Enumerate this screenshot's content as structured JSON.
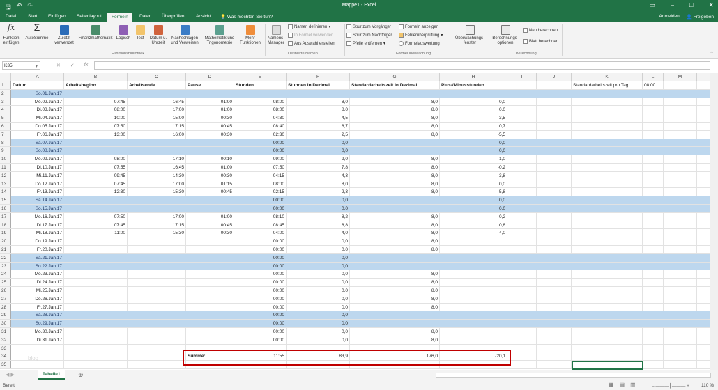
{
  "app": {
    "title": "Mappe1 - Excel",
    "sign_in": "Anmelden",
    "share": "Freigeben",
    "tell_me": "Was möchten Sie tun?"
  },
  "tabs": [
    "Datei",
    "Start",
    "Einfügen",
    "Seitenlayout",
    "Formeln",
    "Daten",
    "Überprüfen",
    "Ansicht"
  ],
  "ribbon": {
    "funktionsbibliothek": {
      "label": "Funktionsbibliothek",
      "buttons": [
        "Funktion einfügen",
        "AutoSumme",
        "Zuletzt verwendet",
        "Finanzmathematik",
        "Logisch",
        "Text",
        "Datum u. Uhrzeit",
        "Nachschlagen und Verweisen",
        "Mathematik und Trigonometrie",
        "Mehr Funktionen"
      ]
    },
    "definierte_namen": {
      "label": "Definierte Namen",
      "manager": "Namens-Manager",
      "items": [
        "Namen definieren",
        "In Formel verwenden",
        "Aus Auswahl erstellen"
      ]
    },
    "formelueberwachung": {
      "label": "Formelüberwachung",
      "items": [
        "Spur zum Vorgänger",
        "Spur zum Nachfolger",
        "Pfeile entfernen",
        "Formeln anzeigen",
        "Fehlerüberprüfung",
        "Formelauswertung"
      ],
      "watch": "Überwachungs-fenster"
    },
    "berechnung": {
      "label": "Berechnung",
      "options": "Berechnungs-optionen",
      "items": [
        "Neu berechnen",
        "Blatt berechnen"
      ]
    }
  },
  "formula_bar": {
    "name_box": "K35",
    "value": ""
  },
  "columns": [
    "A",
    "B",
    "C",
    "D",
    "E",
    "F",
    "G",
    "H",
    "I",
    "J",
    "K",
    "L",
    "M"
  ],
  "header_row": [
    "Datum",
    "Arbeitsbeginn",
    "Arbeitsende",
    "Pause",
    "Stunden",
    "Stunden in Dezimal",
    "Standardarbeitszeit in Dezimal",
    "Plus-/Minusstunden",
    "",
    "",
    "Standardarbeitszeit pro Tag:",
    "08:00",
    ""
  ],
  "rows": [
    {
      "n": 2,
      "we": true,
      "v": [
        "So.01.Jan.17",
        "",
        "",
        "",
        "",
        "",
        "",
        ""
      ]
    },
    {
      "n": 3,
      "v": [
        "Mo.02.Jan.17",
        "07:45",
        "16:45",
        "01:00",
        "08:00",
        "8,0",
        "8,0",
        "0,0"
      ]
    },
    {
      "n": 4,
      "v": [
        "Di.03.Jan.17",
        "08:00",
        "17:00",
        "01:00",
        "08:00",
        "8,0",
        "8,0",
        "0,0"
      ]
    },
    {
      "n": 5,
      "v": [
        "Mi.04.Jan.17",
        "10:00",
        "15:00",
        "00:30",
        "04:30",
        "4,5",
        "8,0",
        "-3,5"
      ]
    },
    {
      "n": 6,
      "v": [
        "Do.05.Jan.17",
        "07:50",
        "17:15",
        "00:45",
        "08:40",
        "8,7",
        "8,0",
        "0,7"
      ]
    },
    {
      "n": 7,
      "v": [
        "Fr.06.Jan.17",
        "13:00",
        "16:00",
        "00:30",
        "02:30",
        "2,5",
        "8,0",
        "-5,5"
      ]
    },
    {
      "n": 8,
      "we": true,
      "v": [
        "Sa.07.Jan.17",
        "",
        "",
        "",
        "00:00",
        "0,0",
        "",
        "0,0"
      ]
    },
    {
      "n": 9,
      "we": true,
      "v": [
        "So.08.Jan.17",
        "",
        "",
        "",
        "00:00",
        "0,0",
        "",
        "0,0"
      ]
    },
    {
      "n": 10,
      "v": [
        "Mo.09.Jan.17",
        "08:00",
        "17:10",
        "00:10",
        "09:00",
        "9,0",
        "8,0",
        "1,0"
      ]
    },
    {
      "n": 11,
      "v": [
        "Di.10.Jan.17",
        "07:55",
        "16:45",
        "01:00",
        "07:50",
        "7,8",
        "8,0",
        "-0,2"
      ]
    },
    {
      "n": 12,
      "v": [
        "Mi.11.Jan.17",
        "09:45",
        "14:30",
        "00:30",
        "04:15",
        "4,3",
        "8,0",
        "-3,8"
      ]
    },
    {
      "n": 13,
      "v": [
        "Do.12.Jan.17",
        "07:45",
        "17:00",
        "01:15",
        "08:00",
        "8,0",
        "8,0",
        "0,0"
      ]
    },
    {
      "n": 14,
      "v": [
        "Fr.13.Jan.17",
        "12:30",
        "15:30",
        "00:45",
        "02:15",
        "2,3",
        "8,0",
        "-5,8"
      ]
    },
    {
      "n": 15,
      "we": true,
      "v": [
        "Sa.14.Jan.17",
        "",
        "",
        "",
        "00:00",
        "0,0",
        "",
        "0,0"
      ]
    },
    {
      "n": 16,
      "we": true,
      "v": [
        "So.15.Jan.17",
        "",
        "",
        "",
        "00:00",
        "0,0",
        "",
        "0,0"
      ]
    },
    {
      "n": 17,
      "v": [
        "Mo.16.Jan.17",
        "07:50",
        "17:00",
        "01:00",
        "08:10",
        "8,2",
        "8,0",
        "0,2"
      ]
    },
    {
      "n": 18,
      "v": [
        "Di.17.Jan.17",
        "07:45",
        "17:15",
        "00:45",
        "08:45",
        "8,8",
        "8,0",
        "0,8"
      ]
    },
    {
      "n": 19,
      "v": [
        "Mi.18.Jan.17",
        "11:00",
        "15:30",
        "00:30",
        "04:00",
        "4,0",
        "8,0",
        "-4,0"
      ]
    },
    {
      "n": 20,
      "v": [
        "Do.19.Jan.17",
        "",
        "",
        "",
        "00:00",
        "0,0",
        "8,0",
        ""
      ]
    },
    {
      "n": 21,
      "v": [
        "Fr.20.Jan.17",
        "",
        "",
        "",
        "00:00",
        "0,0",
        "8,0",
        ""
      ]
    },
    {
      "n": 22,
      "we": true,
      "v": [
        "Sa.21.Jan.17",
        "",
        "",
        "",
        "00:00",
        "0,0",
        "",
        ""
      ]
    },
    {
      "n": 23,
      "we": true,
      "v": [
        "So.22.Jan.17",
        "",
        "",
        "",
        "00:00",
        "0,0",
        "",
        ""
      ]
    },
    {
      "n": 24,
      "v": [
        "Mo.23.Jan.17",
        "",
        "",
        "",
        "00:00",
        "0,0",
        "8,0",
        ""
      ]
    },
    {
      "n": 25,
      "v": [
        "Di.24.Jan.17",
        "",
        "",
        "",
        "00:00",
        "0,0",
        "8,0",
        ""
      ]
    },
    {
      "n": 26,
      "v": [
        "Mi.25.Jan.17",
        "",
        "",
        "",
        "00:00",
        "0,0",
        "8,0",
        ""
      ]
    },
    {
      "n": 27,
      "v": [
        "Do.26.Jan.17",
        "",
        "",
        "",
        "00:00",
        "0,0",
        "8,0",
        ""
      ]
    },
    {
      "n": 28,
      "v": [
        "Fr.27.Jan.17",
        "",
        "",
        "",
        "00:00",
        "0,0",
        "8,0",
        ""
      ]
    },
    {
      "n": 29,
      "we": true,
      "v": [
        "Sa.28.Jan.17",
        "",
        "",
        "",
        "00:00",
        "0,0",
        "",
        ""
      ]
    },
    {
      "n": 30,
      "we": true,
      "v": [
        "So.29.Jan.17",
        "",
        "",
        "",
        "00:00",
        "0,0",
        "",
        ""
      ]
    },
    {
      "n": 31,
      "v": [
        "Mo.30.Jan.17",
        "",
        "",
        "",
        "00:00",
        "0,0",
        "8,0",
        ""
      ]
    },
    {
      "n": 32,
      "v": [
        "Di.31.Jan.17",
        "",
        "",
        "",
        "00:00",
        "0,0",
        "8,0",
        ""
      ]
    },
    {
      "n": 33,
      "v": [
        "",
        "",
        "",
        "",
        "",
        "",
        "",
        ""
      ]
    },
    {
      "n": 34,
      "sum": true,
      "v": [
        "",
        "",
        "",
        "Summe:",
        "11:55",
        "83,9",
        "176,0",
        "-20,1"
      ]
    },
    {
      "n": 35,
      "v": [
        "",
        "",
        "",
        "",
        "",
        "",
        "",
        ""
      ]
    }
  ],
  "watermark": "blog",
  "sheet_tab": "Tabelle1",
  "status": {
    "ready": "Bereit",
    "zoom": "110 %"
  },
  "colors": {
    "accent": "#217346",
    "weekend": "#bdd7ee",
    "highlight": "#c00000"
  }
}
